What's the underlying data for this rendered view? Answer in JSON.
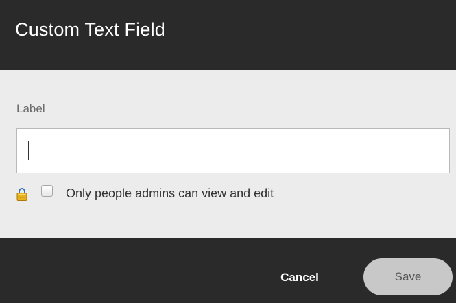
{
  "dialog": {
    "title": "Custom Text Field"
  },
  "form": {
    "label_text": "Label",
    "input_value": "",
    "input_placeholder": "",
    "checkbox_checked": false,
    "checkbox_label": "Only people admins can view and edit",
    "lock_icon": "lock-icon"
  },
  "actions": {
    "cancel_label": "Cancel",
    "save_label": "Save"
  },
  "colors": {
    "header_background": "#2b2a2a",
    "body_background": "#ececec",
    "save_button_background": "#c8c8c8",
    "lock_gold": "#e8b21c",
    "lock_shackle": "#3a6fc4"
  }
}
